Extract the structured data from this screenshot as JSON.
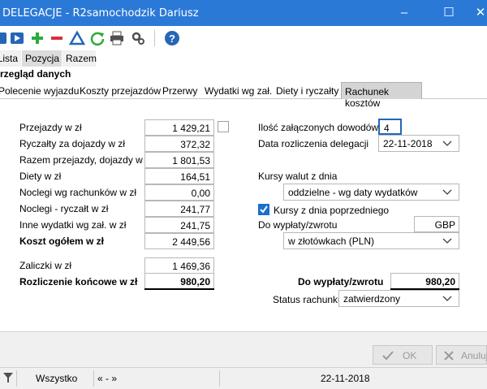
{
  "window": {
    "title": "DELEGACJE - R2samochodzik Dariusz",
    "minimize_glyph": "–",
    "maximize_glyph": "☐",
    "close_glyph": "✕"
  },
  "toolbar": {
    "icons": [
      "first-record-icon",
      "next-record-icon",
      "add-icon",
      "delete-icon",
      "warning-icon",
      "refresh-icon",
      "print-icon",
      "settings-icon",
      "help-icon"
    ],
    "help_glyph": "?"
  },
  "tabs1": [
    {
      "label": "Lista"
    },
    {
      "label": "Pozycja"
    },
    {
      "label": "Razem"
    }
  ],
  "section_title": "Przegląd danych",
  "tabs2": [
    {
      "label": "Polecenie wyjazdu"
    },
    {
      "label": "Koszty przejazdów"
    },
    {
      "label": "Przerwy"
    },
    {
      "label": "Wydatki wg zał."
    },
    {
      "label": "Diety i ryczałty"
    },
    {
      "label": "Rachunek kosztów"
    }
  ],
  "left": {
    "przejazdy_label": "Przejazdy w zł",
    "przejazdy_value": "1 429,21",
    "ryczalty_label": "Ryczałty za dojazdy w zł",
    "ryczalty_value": "372,32",
    "razem_label": "Razem przejazdy, dojazdy w zł",
    "razem_value": "1 801,53",
    "diety_label": "Diety w zł",
    "diety_value": "164,51",
    "noclegi_rach_label": "Noclegi wg rachunków w zł",
    "noclegi_rach_value": "0,00",
    "noclegi_rycz_label": "Noclegi - ryczałt w zł",
    "noclegi_rycz_value": "241,77",
    "inne_label": "Inne wydatki wg zał. w zł",
    "inne_value": "241,75",
    "koszt_label": "Koszt ogółem w zł",
    "koszt_value": "2 449,56",
    "zaliczki_label": "Zaliczki w zł",
    "zaliczki_value": "1 469,36",
    "rozliczenie_label": "Rozliczenie końcowe w zł",
    "rozliczenie_value": "980,20"
  },
  "right": {
    "ilosc_label": "Ilość załączonych dowodów",
    "ilosc_value": "4",
    "data_label": "Data rozliczenia delegacji",
    "data_value": "22-11-2018",
    "kursy_label": "Kursy walut z dnia",
    "kursy_value": "oddzielne - wg daty wydatków",
    "kursy_poprz_label": "Kursy z dnia poprzedniego",
    "kursy_poprz_checked": true,
    "do_wyplaty_label": "Do wypłaty/zwrotu",
    "currency_value": "GBP",
    "waluta_value": "w złotówkach (PLN)",
    "do_wyplaty_bold_label": "Do wypłaty/zwrotu",
    "do_wyplaty_value": "980,20",
    "status_label": "Status rachunku",
    "status_value": "zatwierdzony"
  },
  "buttons": {
    "ok_label": "OK",
    "cancel_label": "Anuluj"
  },
  "statusbar": {
    "filter_value": "Wszystko",
    "range_value": "« - »",
    "date_value": "22-11-2018"
  },
  "colors": {
    "titlebar": "#2b79d7",
    "accent": "#1a6fd0"
  }
}
